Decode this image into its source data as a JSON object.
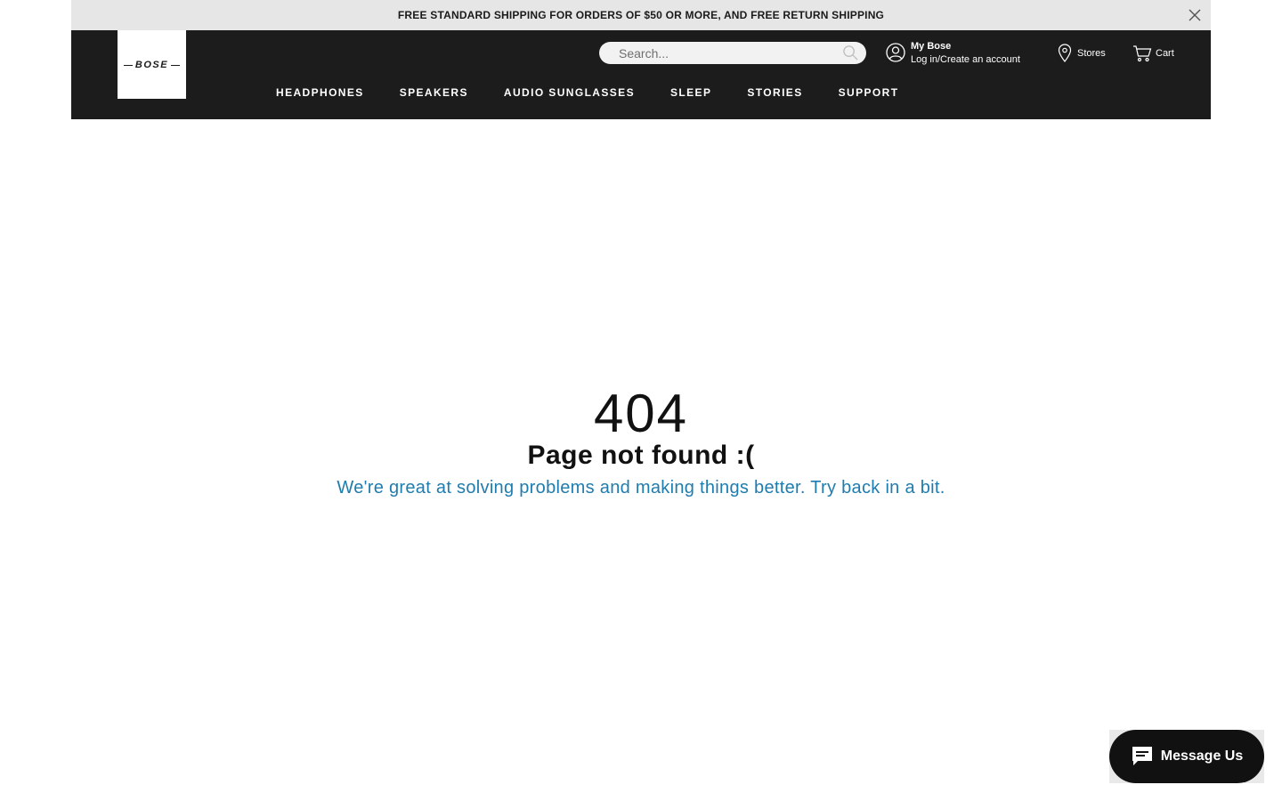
{
  "promo": {
    "text": "FREE STANDARD SHIPPING FOR ORDERS OF $50 OR MORE, AND FREE RETURN SHIPPING"
  },
  "header": {
    "logo_text": "BOSE",
    "search": {
      "placeholder": "Search..."
    },
    "account": {
      "title": "My Bose",
      "link": "Log in/Create an account"
    },
    "stores_label": "Stores",
    "cart_label": "Cart",
    "nav": [
      "HEADPHONES",
      "SPEAKERS",
      "AUDIO SUNGLASSES",
      "SLEEP",
      "STORIES",
      "SUPPORT"
    ]
  },
  "error": {
    "code": "404",
    "title": "Page not found :(",
    "message": "We're great at solving problems and making things better. Try back in a bit."
  },
  "chat": {
    "label": "Message Us"
  },
  "colors": {
    "header_bg": "#1c1c1c",
    "promo_bg": "#e6e6e6",
    "message_link": "#1f7cae"
  }
}
